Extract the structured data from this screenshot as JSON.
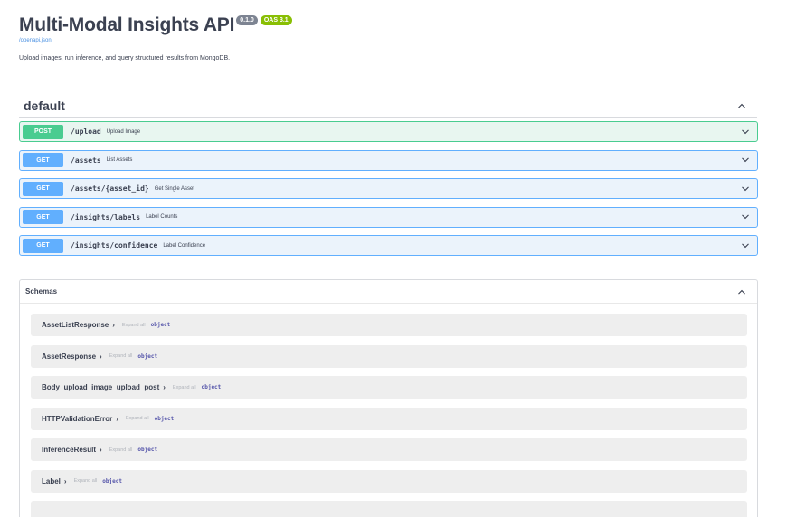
{
  "info": {
    "title": "Multi-Modal Insights API",
    "version_badge": "0.1.0",
    "oas_badge": "OAS 3.1",
    "spec_link": "/openapi.json",
    "description": "Upload images, run inference, and query structured results from MongoDB."
  },
  "tag": {
    "name": "default"
  },
  "operations": [
    {
      "method": "POST",
      "path": "/upload",
      "summary": "Upload Image"
    },
    {
      "method": "GET",
      "path": "/assets",
      "summary": "List Assets"
    },
    {
      "method": "GET",
      "path": "/assets/{asset_id}",
      "summary": "Get Single Asset"
    },
    {
      "method": "GET",
      "path": "/insights/labels",
      "summary": "Label Counts"
    },
    {
      "method": "GET",
      "path": "/insights/confidence",
      "summary": "Label Confidence"
    }
  ],
  "schemas": {
    "title": "Schemas",
    "expand_label": "Expand all",
    "items": [
      {
        "name": "AssetListResponse",
        "type": "object"
      },
      {
        "name": "AssetResponse",
        "type": "object"
      },
      {
        "name": "Body_upload_image_upload_post",
        "type": "object"
      },
      {
        "name": "HTTPValidationError",
        "type": "object"
      },
      {
        "name": "InferenceResult",
        "type": "object"
      },
      {
        "name": "Label",
        "type": "object"
      },
      {
        "name": "",
        "type": ""
      }
    ]
  },
  "icons": {
    "collapse": "chevron-up-icon",
    "expand": "chevron-down-icon"
  },
  "colors": {
    "post": "#49cc90",
    "get": "#61affe",
    "badge_version": "#7d8492",
    "badge_oas": "#89bf04"
  }
}
